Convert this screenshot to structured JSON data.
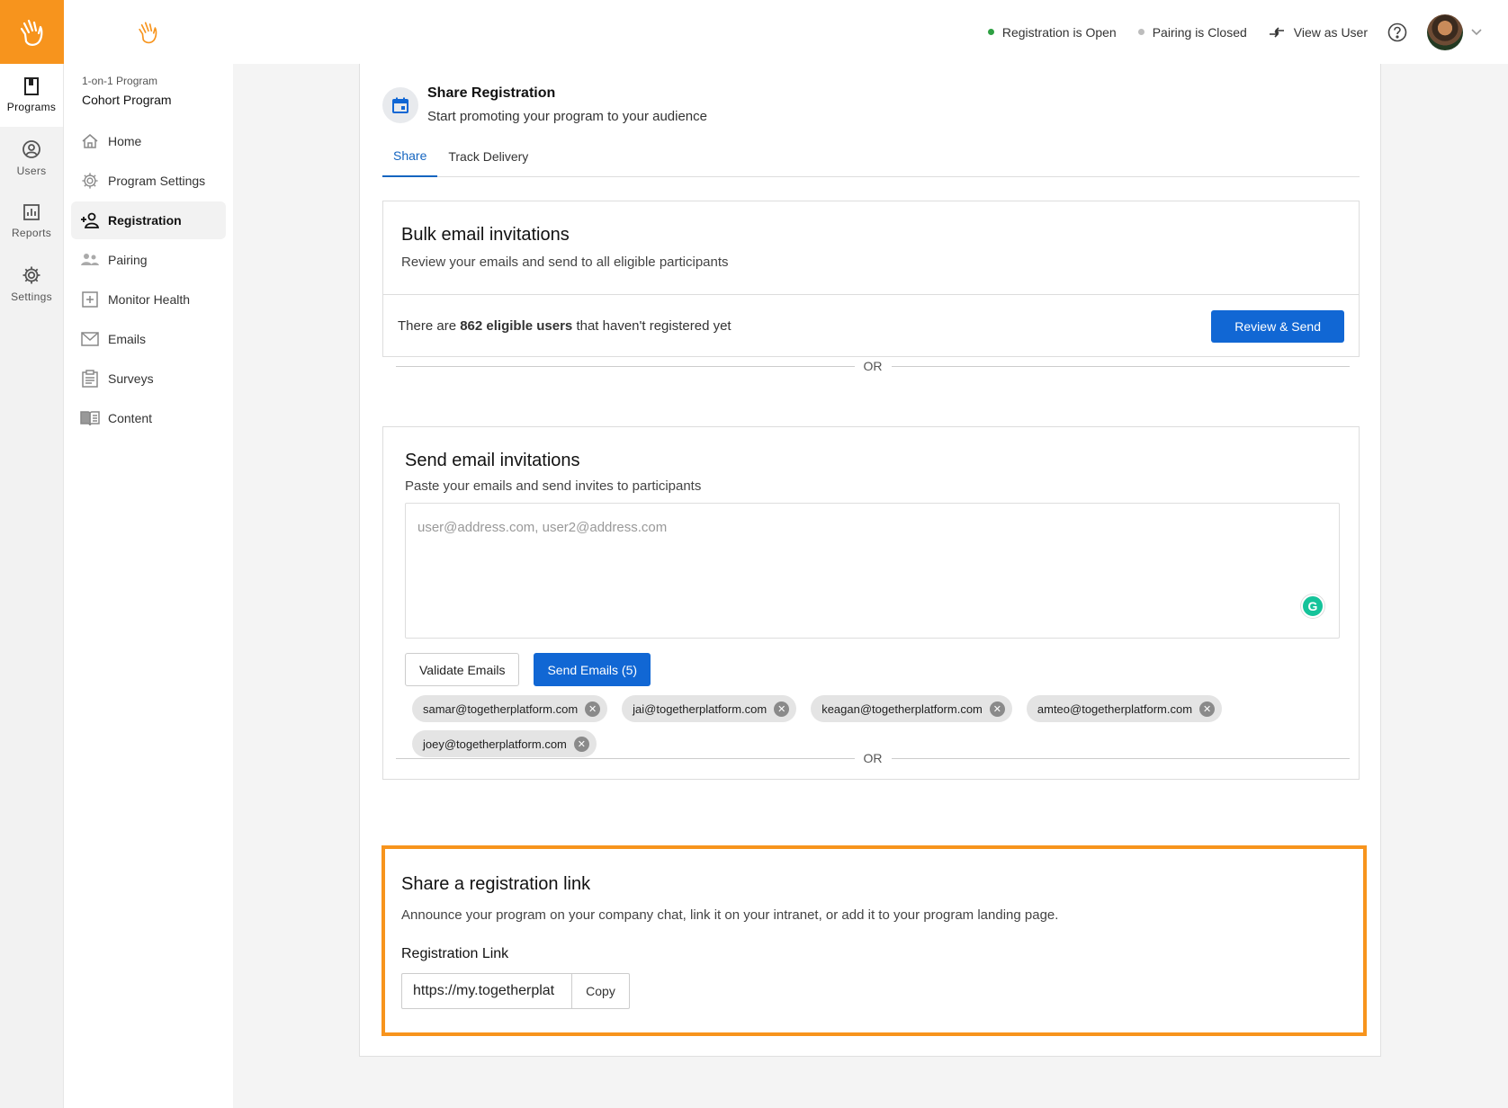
{
  "colors": {
    "brand": "#f7941d",
    "primary": "#1167d4",
    "status_open": "#2ea043",
    "status_closed": "#bdbdbd"
  },
  "rail": {
    "items": [
      {
        "label": "Programs",
        "icon": "book-icon"
      },
      {
        "label": "Users",
        "icon": "user-circle-icon"
      },
      {
        "label": "Reports",
        "icon": "bar-chart-icon"
      },
      {
        "label": "Settings",
        "icon": "gear-icon"
      }
    ]
  },
  "sidebar": {
    "program_type": "1-on-1 Program",
    "program_name": "Cohort Program",
    "items": [
      {
        "label": "Home",
        "icon": "home-icon"
      },
      {
        "label": "Program Settings",
        "icon": "gear-icon"
      },
      {
        "label": "Registration",
        "icon": "add-person-icon"
      },
      {
        "label": "Pairing",
        "icon": "people-icon"
      },
      {
        "label": "Monitor Health",
        "icon": "plus-box-icon"
      },
      {
        "label": "Emails",
        "icon": "mail-icon"
      },
      {
        "label": "Surveys",
        "icon": "clipboard-icon"
      },
      {
        "label": "Content",
        "icon": "book-open-icon"
      }
    ]
  },
  "topbar": {
    "registration_status": "Registration is Open",
    "pairing_status": "Pairing is Closed",
    "view_as_user": "View as User"
  },
  "header": {
    "title": "Share Registration",
    "subtitle": "Start promoting your program to your audience"
  },
  "tabs": [
    {
      "label": "Share"
    },
    {
      "label": "Track Delivery"
    }
  ],
  "bulk": {
    "title": "Bulk email invitations",
    "subtitle": "Review your emails and send to all eligible participants",
    "text_before": "There are ",
    "count_text": "862 eligible users",
    "text_after": " that haven't registered yet",
    "button": "Review & Send"
  },
  "or_label": "OR",
  "send": {
    "title": "Send email invitations",
    "subtitle": "Paste your emails and send invites to participants",
    "placeholder": "user@address.com, user2@address.com",
    "validate_button": "Validate Emails",
    "send_button": "Send Emails (5)",
    "chips": [
      "samar@togetherplatform.com",
      "jai@togetherplatform.com",
      "keagan@togetherplatform.com",
      "amteo@togetherplatform.com",
      "joey@togetherplatform.com"
    ]
  },
  "link": {
    "title": "Share a registration link",
    "subtitle": "Announce your program on your company chat, link it on your intranet, or add it to your program landing page.",
    "label": "Registration Link",
    "value": "https://my.togetherplat",
    "copy_button": "Copy"
  }
}
